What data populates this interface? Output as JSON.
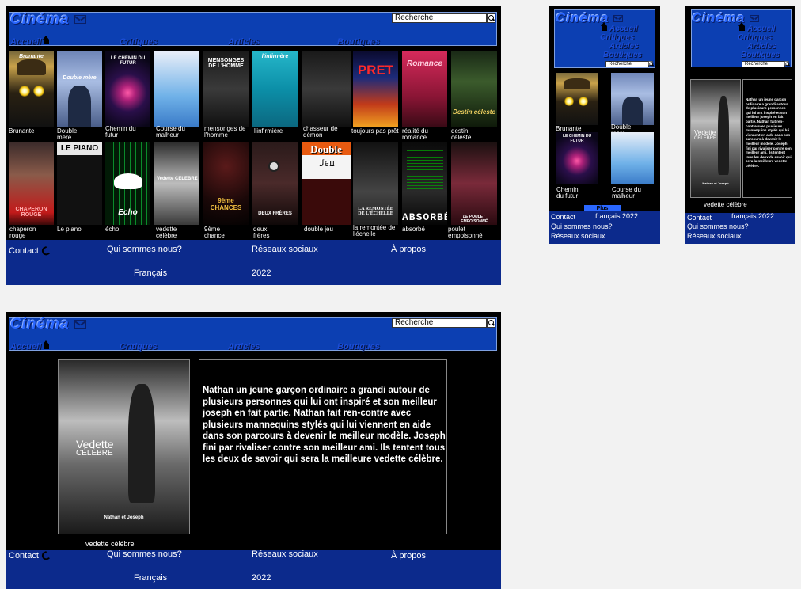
{
  "site": {
    "logo": "Cinéma",
    "search_placeholder": "Recherche",
    "nav": [
      "Accueil",
      "Critiques",
      "Articles",
      "Boutiques"
    ],
    "mail_icon": "mail-icon",
    "home_icon": "house-icon"
  },
  "grid": {
    "row1": [
      {
        "caption": "Brunante",
        "poster_title": "Brunante",
        "icon": "glowing-eyes"
      },
      {
        "caption": "Double mère",
        "poster_title": "Double mère"
      },
      {
        "caption": "Chemin du futur",
        "poster_title": "LE CHEMIN DU FUTUR"
      },
      {
        "caption": "Course du malheur",
        "poster_title": ""
      },
      {
        "caption": "mensonges de l'homme",
        "poster_title": "MENSONGES DE L'HOMME"
      },
      {
        "caption": "l'infirmière",
        "poster_title": "l'infirmère"
      },
      {
        "caption": "chasseur de démon",
        "poster_title": ""
      },
      {
        "caption": "toujours pas prêt",
        "poster_title": "PRET"
      },
      {
        "caption": "réalité du romance",
        "poster_title": "Romance"
      },
      {
        "caption": "destin céleste",
        "poster_title": "Destin céleste"
      }
    ],
    "row2": [
      {
        "caption": "chaperon rouge",
        "poster_title": "CHAPERON ROUGE"
      },
      {
        "caption": "Le piano",
        "poster_title": "LE PIANO"
      },
      {
        "caption": "écho",
        "poster_title": "Echo"
      },
      {
        "caption": "vedette célèbre",
        "poster_title": "Vedette CELEBRE"
      },
      {
        "caption": "9ème chance",
        "poster_title": "9ème CHANCES"
      },
      {
        "caption": "deux frères",
        "poster_title": "DEUX FRÈRES"
      },
      {
        "caption": "double jeu",
        "poster_title": "Double Jeu"
      },
      {
        "caption": "la remontée de l'échelle",
        "poster_title": "LA REMONTÉE DE L'ÉCHELLE"
      },
      {
        "caption": "absorbé",
        "poster_title": "ABSORBÉ"
      },
      {
        "caption": "poulet empoisonné",
        "poster_title": "LE POULET EMPOISONNÉ"
      }
    ]
  },
  "footer": {
    "contact": "Contact",
    "about_us": "Qui sommes nous?",
    "social": "Réseaux sociaux",
    "about": "À propos",
    "language": "Français",
    "year": "2022",
    "language_short": "français 2022",
    "phone_icon": "phone-icon"
  },
  "mobile": {
    "more_button": "Plus",
    "grid": [
      {
        "caption": "Brunante"
      },
      {
        "caption": "Double mère"
      },
      {
        "caption": "Chemin du futur"
      },
      {
        "caption": "Course du malheur"
      }
    ]
  },
  "detail": {
    "poster_title_1": "Vedette",
    "poster_title_2": "CÉLÈBRE",
    "poster_credit": "Nathan et Joseph",
    "caption": "vedette célèbre",
    "description": "Nathan un jeune garçon ordinaire a grandi autour de plusieurs personnes qui lui ont inspiré et son meilleur joseph en fait partie. Nathan fait ren-contre avec plusieurs mannequins stylés qui lui viennent en aide dans son parcours à devenir le meilleur modèle. Joseph fini par rivaliser contre son meilleur ami. Ils tentent tous les deux de savoir qui sera la meilleure vedette célèbre."
  },
  "colors": {
    "header": "#0c3fb2",
    "logo": "#2a67ff",
    "footer": "#0c2a8c",
    "page": "#000000"
  }
}
